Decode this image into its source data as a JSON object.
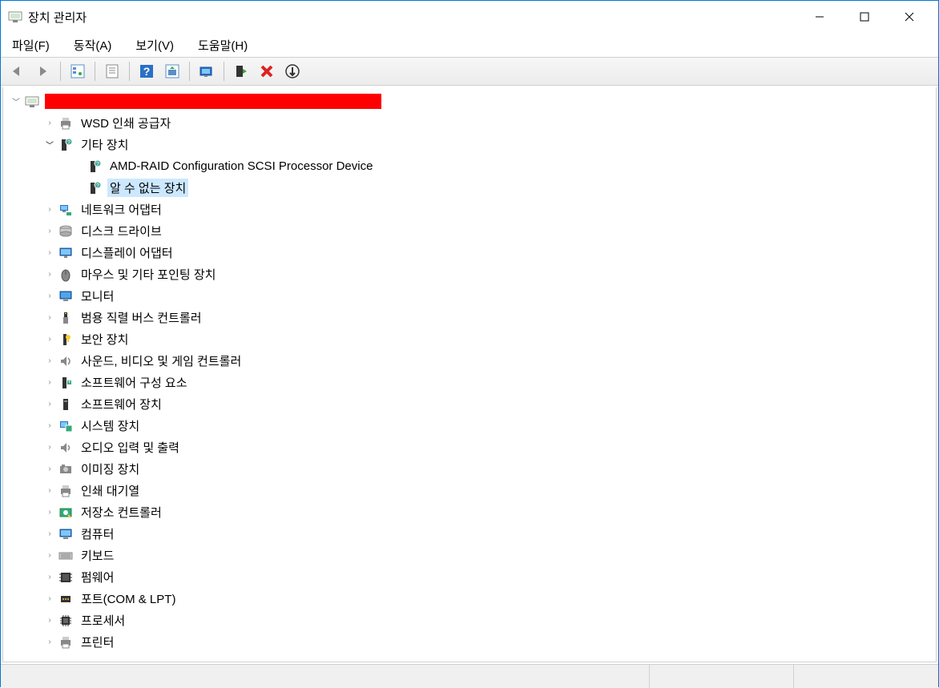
{
  "window": {
    "title": "장치 관리자"
  },
  "menu": {
    "file": "파일(F)",
    "action": "동작(A)",
    "view": "보기(V)",
    "help": "도움말(H)"
  },
  "tree": {
    "root_redacted": true,
    "categories": [
      {
        "label": "WSD 인쇄 공급자",
        "icon": "printer",
        "expanded": false
      },
      {
        "label": "기타 장치",
        "icon": "other",
        "expanded": true,
        "children": [
          {
            "label": "AMD-RAID Configuration SCSI Processor Device",
            "icon": "unknown-device",
            "selected": false
          },
          {
            "label": "알 수 없는 장치",
            "icon": "unknown-device",
            "selected": true
          }
        ]
      },
      {
        "label": "네트워크 어댑터",
        "icon": "network",
        "expanded": false
      },
      {
        "label": "디스크 드라이브",
        "icon": "disk",
        "expanded": false
      },
      {
        "label": "디스플레이 어댑터",
        "icon": "display",
        "expanded": false
      },
      {
        "label": "마우스 및 기타 포인팅 장치",
        "icon": "mouse",
        "expanded": false
      },
      {
        "label": "모니터",
        "icon": "monitor",
        "expanded": false
      },
      {
        "label": "범용 직렬 버스 컨트롤러",
        "icon": "usb",
        "expanded": false
      },
      {
        "label": "보안 장치",
        "icon": "security",
        "expanded": false
      },
      {
        "label": "사운드, 비디오 및 게임 컨트롤러",
        "icon": "sound",
        "expanded": false
      },
      {
        "label": "소프트웨어 구성 요소",
        "icon": "sw-component",
        "expanded": false
      },
      {
        "label": "소프트웨어 장치",
        "icon": "sw-device",
        "expanded": false
      },
      {
        "label": "시스템 장치",
        "icon": "system",
        "expanded": false
      },
      {
        "label": "오디오 입력 및 출력",
        "icon": "audio",
        "expanded": false
      },
      {
        "label": "이미징 장치",
        "icon": "imaging",
        "expanded": false
      },
      {
        "label": "인쇄 대기열",
        "icon": "print-queue",
        "expanded": false
      },
      {
        "label": "저장소 컨트롤러",
        "icon": "storage",
        "expanded": false
      },
      {
        "label": "컴퓨터",
        "icon": "computer",
        "expanded": false
      },
      {
        "label": "키보드",
        "icon": "keyboard",
        "expanded": false
      },
      {
        "label": "펌웨어",
        "icon": "firmware",
        "expanded": false
      },
      {
        "label": "포트(COM & LPT)",
        "icon": "port",
        "expanded": false
      },
      {
        "label": "프로세서",
        "icon": "processor",
        "expanded": false
      },
      {
        "label": "프린터",
        "icon": "printer2",
        "expanded": false
      }
    ]
  }
}
